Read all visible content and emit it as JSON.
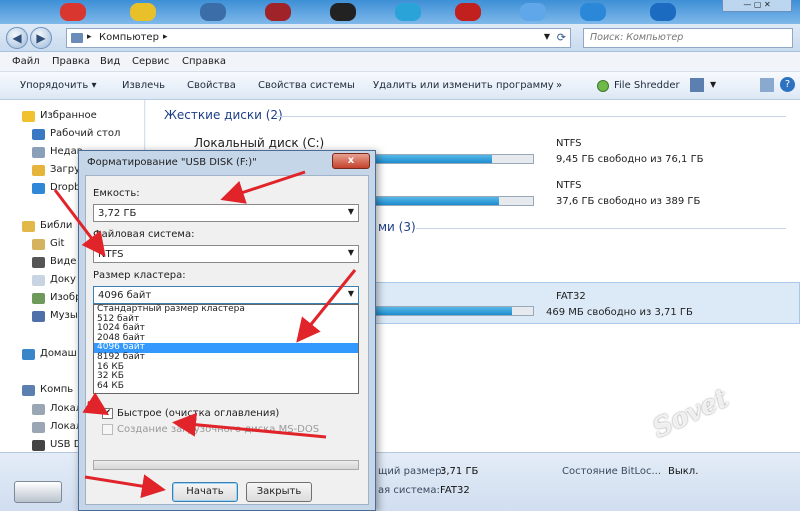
{
  "colors": {
    "accent": "#3399ff",
    "red_arrow": "#e0242a"
  },
  "nav": {
    "address_icon": "computer-icon",
    "address_path": "Компьютер",
    "search_placeholder": "Поиск: Компьютер"
  },
  "menu": [
    "Файл",
    "Правка",
    "Вид",
    "Сервис",
    "Справка"
  ],
  "toolbar": {
    "organize": "Упорядочить ▾",
    "eject": "Извлечь",
    "properties": "Свойства",
    "system_properties": "Свойства системы",
    "uninstall": "Удалить или изменить программу",
    "more": "»",
    "file_shredder": "File Shredder"
  },
  "sidebar": {
    "favorites": "Избранное",
    "desktop": "Рабочий стол",
    "recent": "Недав",
    "downloads": "Загру",
    "dropbox": "Dropb",
    "libraries": "Библи",
    "git": "Git",
    "video": "Виде",
    "documents": "Доку",
    "images": "Изобр",
    "music": "Музы",
    "homegroup": "Домаш",
    "computer": "Компь",
    "local1": "Локал",
    "local2": "Локал",
    "usb": "USB D"
  },
  "content": {
    "hard_drives_group": "Жесткие диски (2)",
    "local_disk_c": "Локальный диск (C:)",
    "c_fs": "NTFS",
    "c_free": "9,45 ГБ свободно из 76,1 ГБ",
    "c_used_fraction": 0.88,
    "d_fs": "NTFS",
    "d_free": "37,6 ГБ свободно из 389 ГБ",
    "d_used_fraction": 0.9,
    "removable_group_tail": "ми (3)",
    "usb_fs": "FAT32",
    "usb_free": "469 МБ свободно из 3,71 ГБ",
    "usb_used_fraction": 0.87
  },
  "details": {
    "total_size_label": "щий размер:",
    "total_size_value": "3,71 ГБ",
    "bitlocker": "Состояние BitLoc...",
    "bitlocker_value": "Выкл.",
    "filesystem_label": "ая система:",
    "filesystem_value": "FAT32"
  },
  "dialog": {
    "title": "Форматирование \"USB DISK (F:)\"",
    "close": "x",
    "capacity_label": "Емкость:",
    "capacity_value": "3,72 ГБ",
    "filesystem_label": "Файловая система:",
    "filesystem_value": "NTFS",
    "cluster_label": "Размер кластера:",
    "cluster_value": "4096 байт",
    "cluster_options": [
      "Стандартный размер кластера",
      "512 байт",
      "1024 байт",
      "2048 байт",
      "4096 байт",
      "8192 байт",
      "16 КБ",
      "32 КБ",
      "64 КБ"
    ],
    "cluster_selected_index": 4,
    "quick_format": "Быстрое (очистка оглавления)",
    "quick_checked": true,
    "msdos": "Создание загрузочного диска MS-DOS",
    "start": "Начать",
    "close_btn": "Закрыть"
  }
}
